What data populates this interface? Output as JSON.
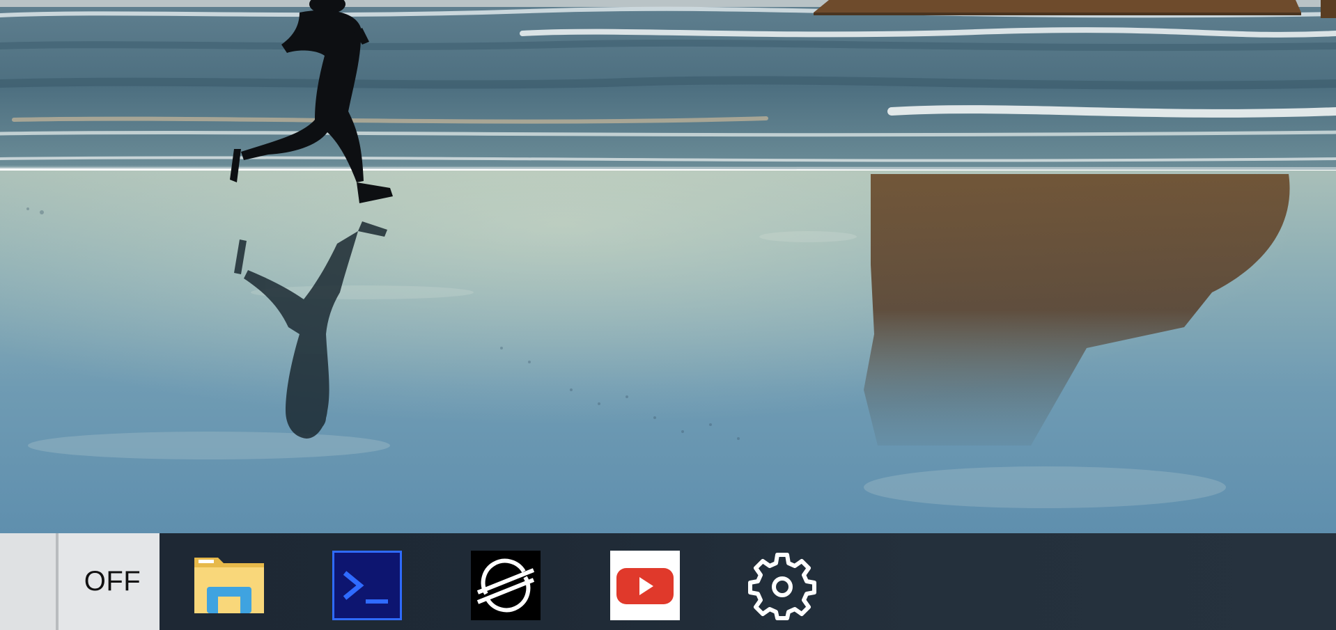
{
  "desktop": {
    "wallpaper": "beach-runner-wallpaper"
  },
  "taskbar": {
    "power_toggle": {
      "label": "OFF"
    },
    "apps": [
      {
        "name": "file-explorer",
        "icon": "folder-icon"
      },
      {
        "name": "terminal",
        "icon": "terminal-icon"
      },
      {
        "name": "stellar",
        "icon": "stellar-icon"
      },
      {
        "name": "youtube",
        "icon": "youtube-icon"
      },
      {
        "name": "settings",
        "icon": "gear-icon"
      }
    ]
  },
  "colors": {
    "taskbar_bg": "#1f2a36",
    "toggle_bg": "#e4e6e8",
    "terminal_bg": "#0d1570",
    "terminal_accent": "#2f6bff",
    "youtube_red": "#e0392b"
  }
}
